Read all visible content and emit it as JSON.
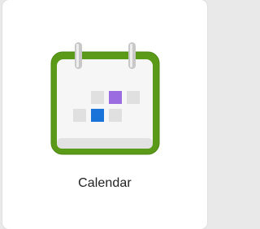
{
  "app": {
    "label": "Calendar",
    "icon": "calendar-icon"
  },
  "colors": {
    "frame": "#5a9a18",
    "page": "#ededed",
    "cell": "#e0e0e0",
    "highlight_purple": "#9b6ce0",
    "highlight_blue": "#1a73d9",
    "rings": "#c8c8c8"
  }
}
